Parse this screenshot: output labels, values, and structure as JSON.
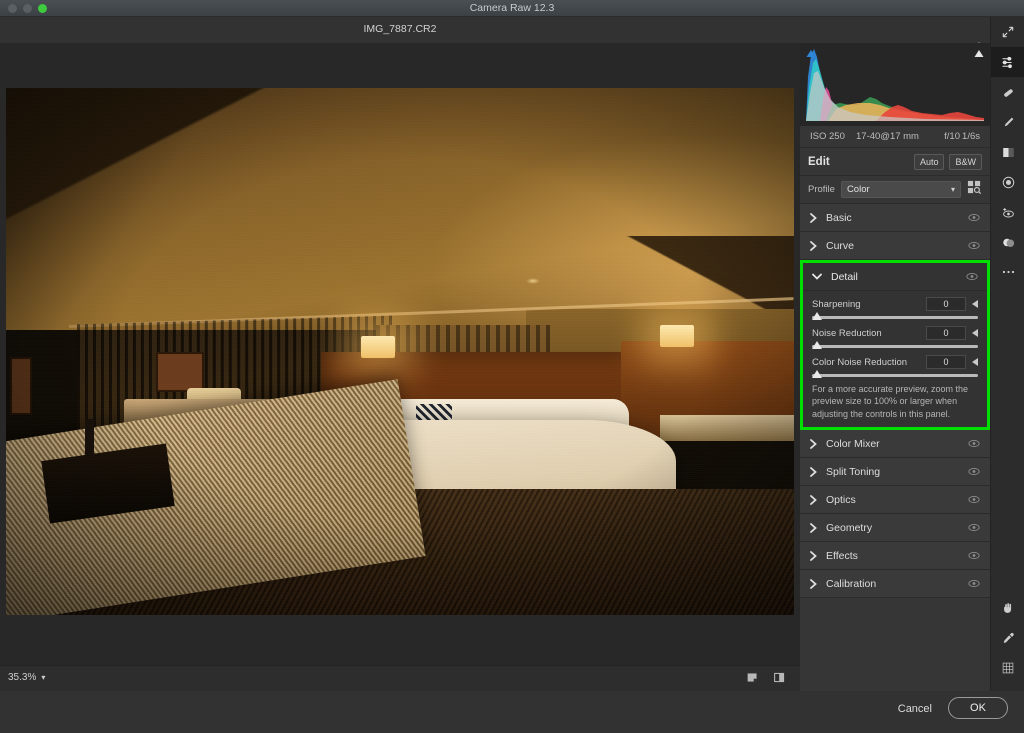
{
  "window": {
    "title": "Camera Raw 12.3",
    "filename": "IMG_7887.CR2",
    "gear_icon": "gear-icon",
    "expand_icon": "expand-arrows-icon"
  },
  "metadata": {
    "iso": "ISO 250",
    "lens": "17-40@17 mm",
    "aperture": "f/10",
    "shutter": "1/6s"
  },
  "edit": {
    "title": "Edit",
    "auto_label": "Auto",
    "bw_label": "B&W"
  },
  "profile": {
    "label": "Profile",
    "value": "Color",
    "browser_icon": "profile-browser-icon"
  },
  "panels": [
    {
      "name": "Basic",
      "expanded": false
    },
    {
      "name": "Curve",
      "expanded": false
    },
    {
      "name": "Color Mixer",
      "expanded": false
    },
    {
      "name": "Split Toning",
      "expanded": false
    },
    {
      "name": "Optics",
      "expanded": false
    },
    {
      "name": "Geometry",
      "expanded": false
    },
    {
      "name": "Effects",
      "expanded": false
    },
    {
      "name": "Calibration",
      "expanded": false
    }
  ],
  "detail": {
    "title": "Detail",
    "highlighted": true,
    "highlight_color": "#00e000",
    "sliders": [
      {
        "label": "Sharpening",
        "value": "0",
        "position_pct": 0
      },
      {
        "label": "Noise Reduction",
        "value": "0",
        "position_pct": 0
      },
      {
        "label": "Color Noise Reduction",
        "value": "0",
        "position_pct": 0
      }
    ],
    "note": "For a more accurate preview, zoom the preview size to 100% or larger when adjusting the controls in this panel."
  },
  "canvas": {
    "zoom_level": "35.3%",
    "zoom_chevron": "chevron-down-icon",
    "view_icons": [
      "single-view-icon",
      "before-after-view-icon"
    ],
    "photo_alt": "Dimly lit hotel room with king bed, warm tungsten lighting, granite counter in foreground"
  },
  "tools": [
    "expand-arrows-icon",
    "edit-sliders-icon",
    "spot-heal-icon",
    "adjustment-brush-icon",
    "graduated-filter-icon",
    "radial-filter-icon",
    "red-eye-icon",
    "masking-icon",
    "more-options-icon"
  ],
  "tools_bottom": [
    "hand-icon",
    "eyedropper-icon",
    "grid-overlay-icon"
  ],
  "footer": {
    "cancel_label": "Cancel",
    "ok_label": "OK"
  }
}
